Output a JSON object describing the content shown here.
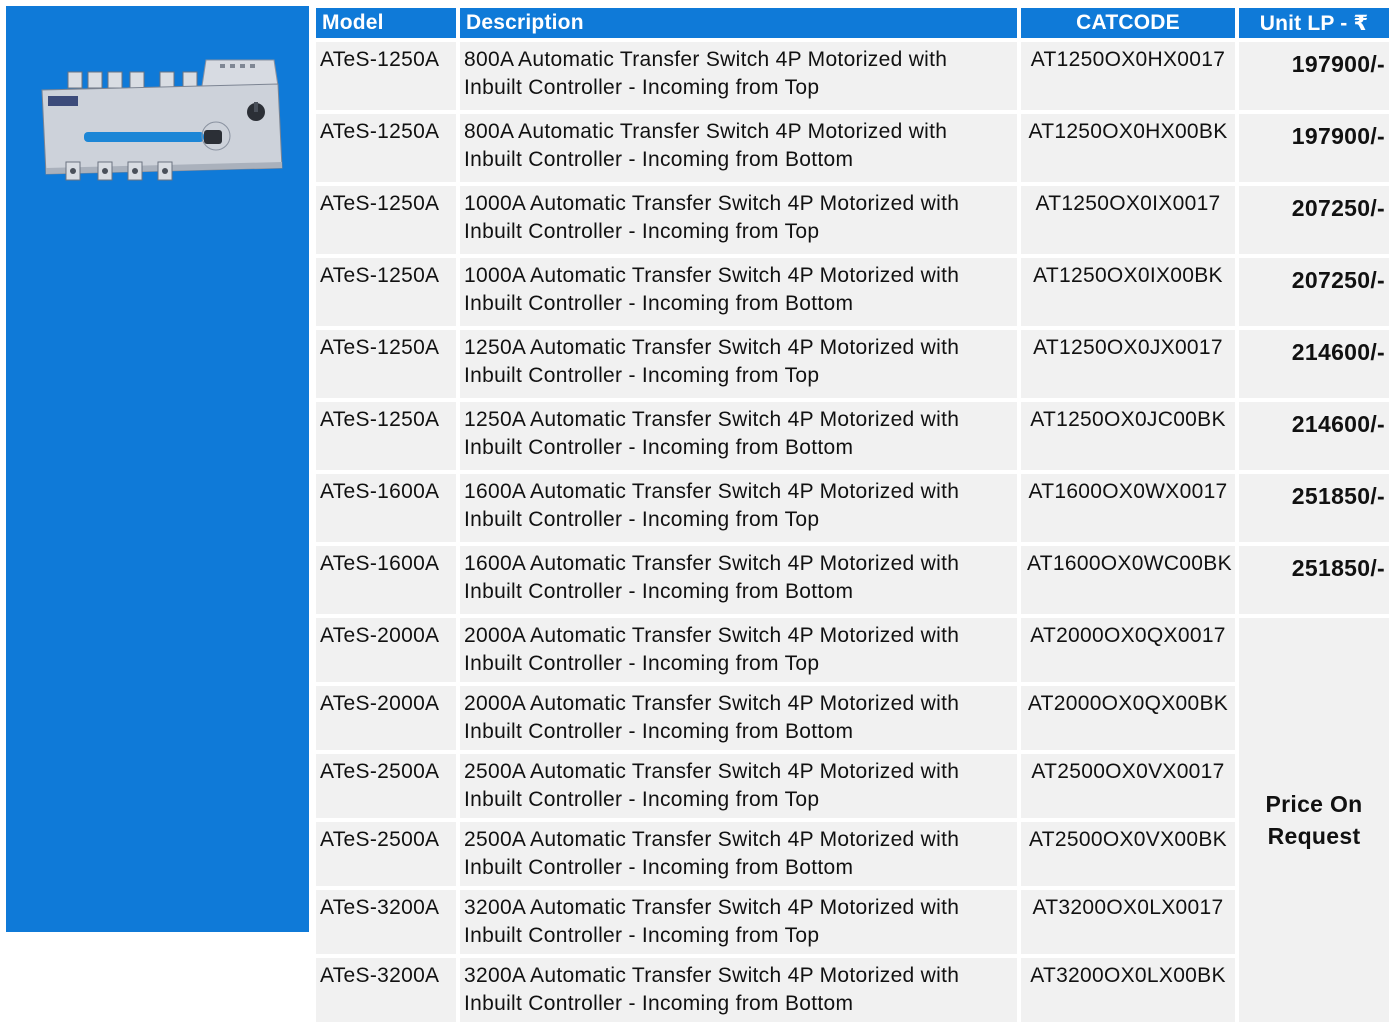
{
  "headers": {
    "model": "Model",
    "description": "Description",
    "catcode": "CATCODE",
    "price": "Unit LP - ₹"
  },
  "rows": [
    {
      "model": "ATeS-1250A",
      "desc1": "800A Automatic Transfer Switch 4P Motorized with",
      "desc2": "Inbuilt Controller - Incoming from Top",
      "catcode": "AT1250OX0HX0017",
      "price": "197900/-"
    },
    {
      "model": "ATeS-1250A",
      "desc1": "800A Automatic Transfer Switch 4P Motorized with",
      "desc2": "Inbuilt Controller - Incoming from Bottom",
      "catcode": "AT1250OX0HX00BK",
      "price": "197900/-"
    },
    {
      "model": "ATeS-1250A",
      "desc1": "1000A Automatic Transfer Switch 4P Motorized with",
      "desc2": "Inbuilt Controller - Incoming from Top",
      "catcode": "AT1250OX0IX0017",
      "price": "207250/-"
    },
    {
      "model": "ATeS-1250A",
      "desc1": "1000A Automatic Transfer Switch 4P Motorized with",
      "desc2": "Inbuilt Controller - Incoming from Bottom",
      "catcode": "AT1250OX0IX00BK",
      "price": "207250/-"
    },
    {
      "model": "ATeS-1250A",
      "desc1": "1250A Automatic Transfer Switch 4P Motorized with",
      "desc2": "Inbuilt Controller - Incoming from Top",
      "catcode": "AT1250OX0JX0017",
      "price": "214600/-"
    },
    {
      "model": "ATeS-1250A",
      "desc1": "1250A Automatic Transfer Switch 4P Motorized with",
      "desc2": "Inbuilt Controller - Incoming from Bottom",
      "catcode": "AT1250OX0JC00BK",
      "price": "214600/-"
    },
    {
      "model": "ATeS-1600A",
      "desc1": "1600A Automatic Transfer Switch 4P Motorized with",
      "desc2": "Inbuilt Controller - Incoming from Top",
      "catcode": "AT1600OX0WX0017",
      "price": "251850/-"
    },
    {
      "model": "ATeS-1600A",
      "desc1": "1600A Automatic Transfer Switch 4P Motorized with",
      "desc2": "Inbuilt Controller - Incoming from Bottom",
      "catcode": "AT1600OX0WC00BK",
      "price": "251850/-"
    },
    {
      "model": "ATeS-2000A",
      "desc1": "2000A Automatic Transfer Switch 4P Motorized with",
      "desc2": "Inbuilt Controller - Incoming from Top",
      "catcode": "AT2000OX0QX0017"
    },
    {
      "model": "ATeS-2000A",
      "desc1": "2000A Automatic Transfer Switch 4P Motorized with",
      "desc2": "Inbuilt Controller - Incoming from Bottom",
      "catcode": "AT2000OX0QX00BK"
    },
    {
      "model": "ATeS-2500A",
      "desc1": "2500A Automatic Transfer Switch 4P Motorized with",
      "desc2": "Inbuilt Controller - Incoming from Top",
      "catcode": "AT2500OX0VX0017"
    },
    {
      "model": "ATeS-2500A",
      "desc1": "2500A Automatic Transfer Switch 4P Motorized with",
      "desc2": "Inbuilt Controller - Incoming from Bottom",
      "catcode": "AT2500OX0VX00BK"
    },
    {
      "model": "ATeS-3200A",
      "desc1": "3200A Automatic Transfer Switch 4P Motorized with",
      "desc2": "Inbuilt Controller - Incoming from Top",
      "catcode": "AT3200OX0LX0017"
    },
    {
      "model": "ATeS-3200A",
      "desc1": "3200A Automatic Transfer Switch 4P Motorized with",
      "desc2": "Inbuilt Controller - Incoming from Bottom",
      "catcode": "AT3200OX0LX00BK"
    }
  ],
  "price_on_request": {
    "line1": "Price On",
    "line2": "Request"
  },
  "colors": {
    "accent": "#0f7ad8",
    "row_bg": "#f1f1f1"
  },
  "product_image": "automatic-transfer-switch-icon"
}
